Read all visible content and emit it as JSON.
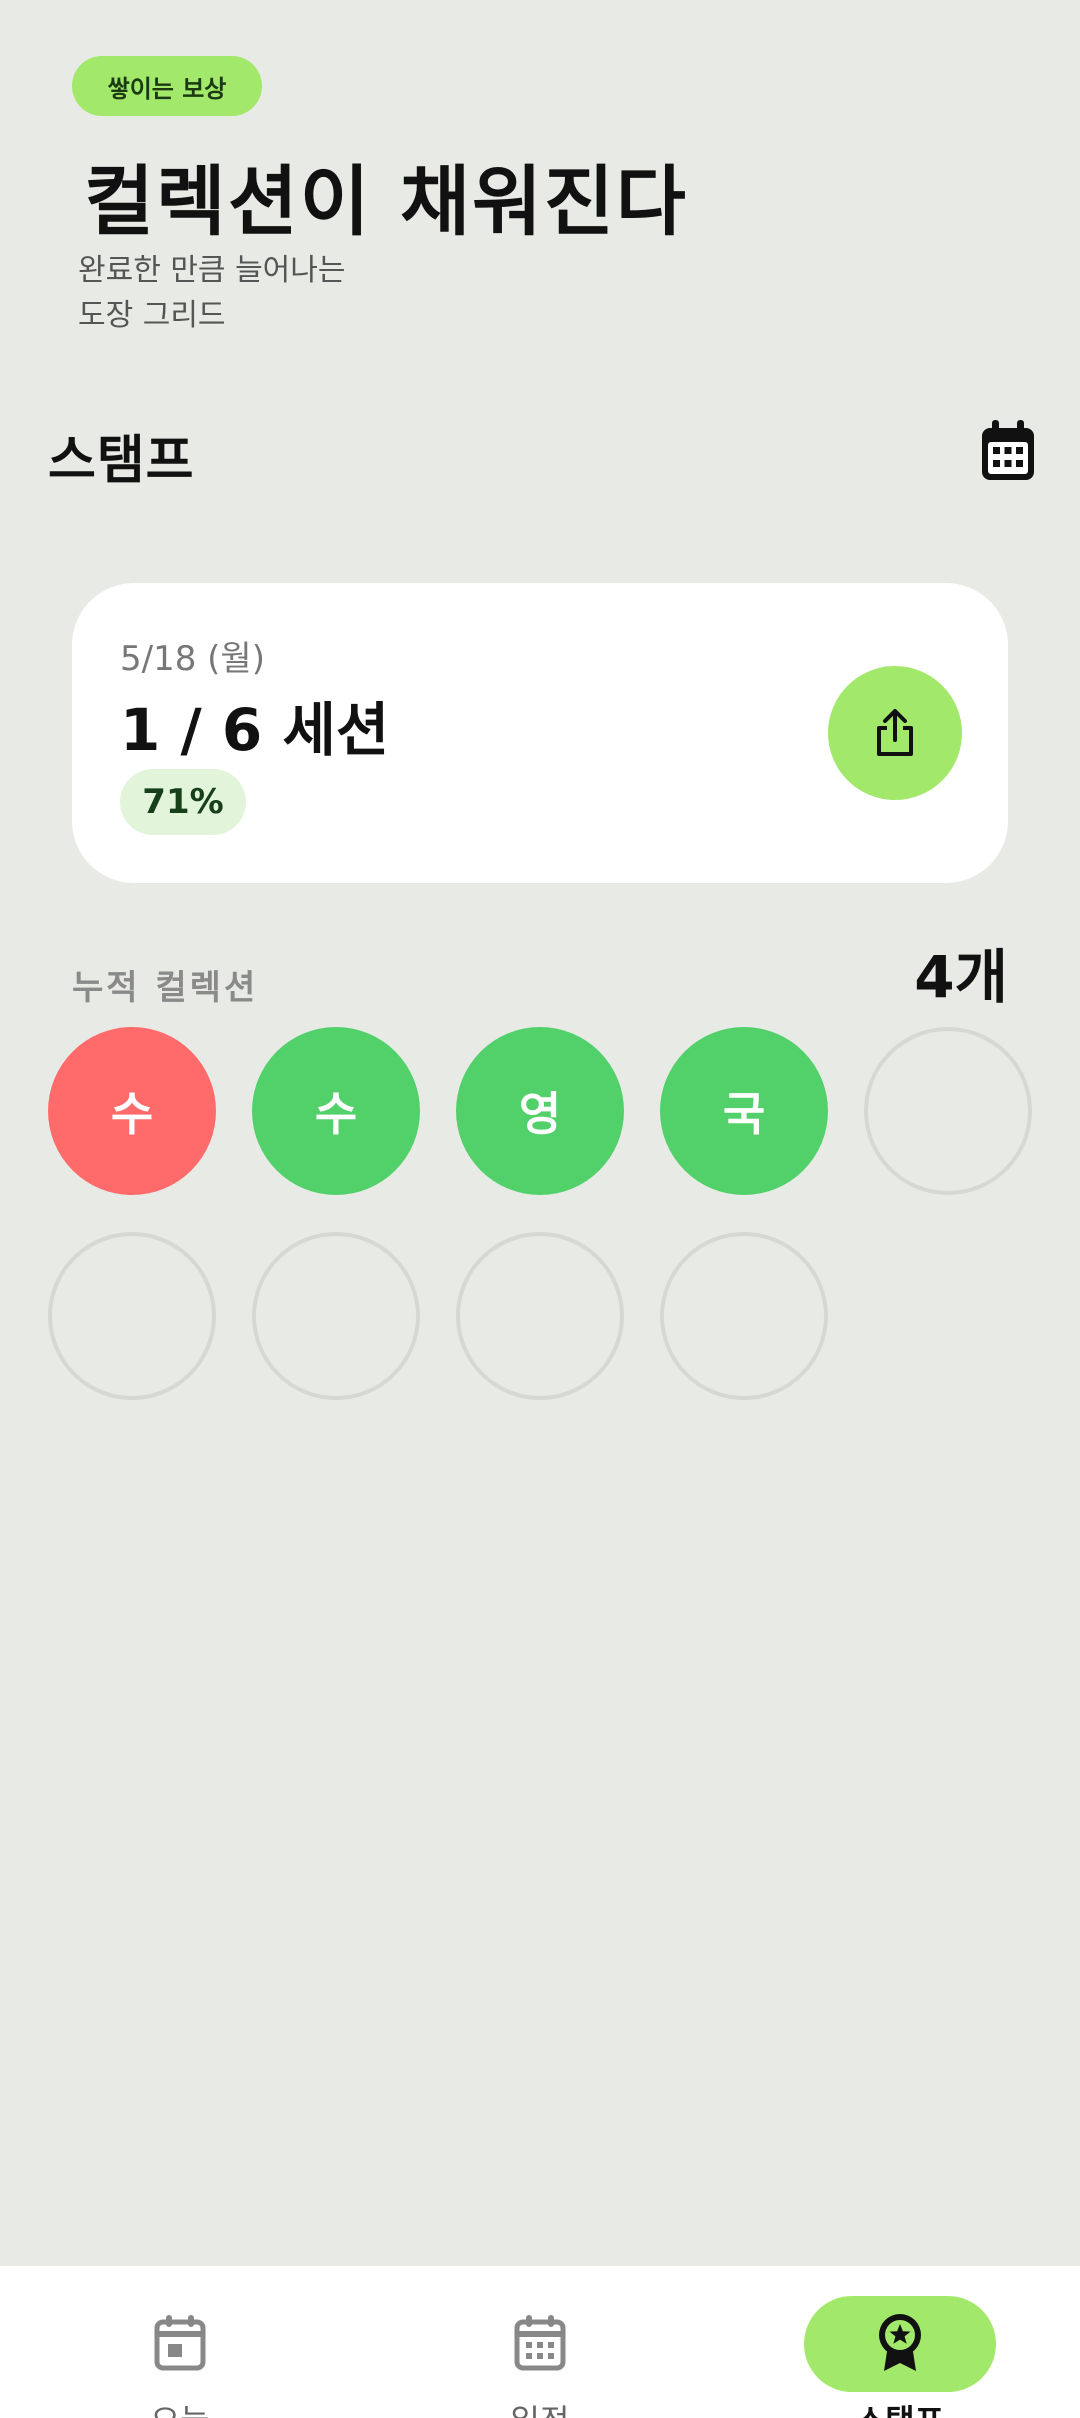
{
  "promo": {
    "badge": "쌓이는 보상",
    "title": "컬렉션이 채워진다",
    "subtitle_lines": [
      "완료한 만큼 늘어나는",
      "도장 그리드"
    ]
  },
  "header": {
    "title": "스탬프",
    "calendar_icon": "calendar-icon"
  },
  "summary_card": {
    "date": "5/18 (월)",
    "sessions": "1 / 6 세션",
    "percent": "71%",
    "share_icon": "share-icon"
  },
  "collection": {
    "label": "누적 컬렉션",
    "count": "4개",
    "stamps": [
      {
        "label": "수",
        "color": "#ff6b6b",
        "filled": true
      },
      {
        "label": "수",
        "color": "#52d06a",
        "filled": true
      },
      {
        "label": "영",
        "color": "#52d06a",
        "filled": true
      },
      {
        "label": "국",
        "color": "#52d06a",
        "filled": true
      },
      {
        "label": "",
        "filled": false
      },
      {
        "label": "",
        "filled": false
      },
      {
        "label": "",
        "filled": false
      },
      {
        "label": "",
        "filled": false
      },
      {
        "label": "",
        "filled": false
      }
    ]
  },
  "bottom_nav": {
    "items": [
      {
        "label": "오늘",
        "icon": "calendar-day-icon",
        "active": false
      },
      {
        "label": "일정",
        "icon": "calendar-grid-icon",
        "active": false
      },
      {
        "label": "스탬프",
        "icon": "award-ribbon-icon",
        "active": true
      }
    ]
  },
  "colors": {
    "accent_green": "#a2e86b",
    "stamp_green": "#52d06a",
    "stamp_red": "#ff6b6b",
    "background": "#e8eae6"
  }
}
